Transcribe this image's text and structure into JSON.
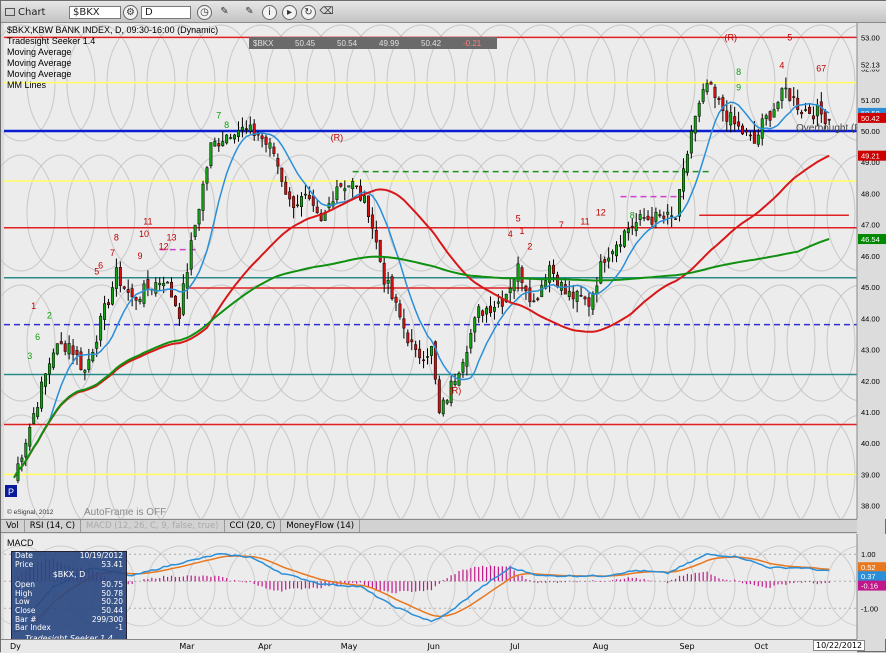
{
  "toolbar": {
    "chart_label": "Chart",
    "symbol": "$BKX",
    "interval": "D"
  },
  "header": {
    "title": "$BKX,KBW BANK INDEX, D, 09:30-16:00 (Dynamic)",
    "quote_symbol": "$BKX",
    "quote_1": "50.45",
    "quote_2": "50.54",
    "quote_3": "49.99",
    "quote_4": "50.42",
    "quote_5": "-0.21"
  },
  "studies": [
    "Tradesight Seeker 1.4",
    "Moving Average",
    "Moving Average",
    "Moving Average",
    "MM Lines"
  ],
  "notes": {
    "overbought": "Overbought (F",
    "autoframe": "AutoFrame is OFF",
    "copyright": "© eSignal, 2012"
  },
  "price_axis": {
    "ticks": [
      "53.00",
      "52.00",
      "51.00",
      "50.00",
      "49.00",
      "48.00",
      "47.00",
      "46.00",
      "45.00",
      "44.00",
      "43.00",
      "42.00",
      "41.00",
      "40.00",
      "39.00",
      "38.00"
    ],
    "tags": [
      {
        "text": "52.13",
        "value": 52.13,
        "color": "#dcdcdc",
        "fg": "#000"
      },
      {
        "text": "50.58",
        "value": 50.58,
        "color": "#2a8fd8",
        "fg": "#fff"
      },
      {
        "text": "50.42",
        "value": 50.42,
        "color": "#cc0000",
        "fg": "#fff"
      },
      {
        "text": "49.21",
        "value": 49.21,
        "color": "#cc0000",
        "fg": "#fff"
      },
      {
        "text": "46.54",
        "value": 46.54,
        "color": "#008800",
        "fg": "#fff"
      }
    ]
  },
  "macd_axis": {
    "ticks": [
      "1.00",
      "0.00",
      "-1.00"
    ],
    "tags": [
      {
        "text": "0.52",
        "value": 0.52,
        "color": "#e87820"
      },
      {
        "text": "0.37",
        "value": 0.37,
        "color": "#2a8fd8"
      },
      {
        "text": "-0.16",
        "value": -0.16,
        "color": "#c0188a"
      }
    ]
  },
  "tabs": [
    {
      "label": "Vol",
      "dim": false
    },
    {
      "label": "RSI (14, C)",
      "dim": false
    },
    {
      "label": "MACD (12, 26, C, 9, false, true)",
      "dim": true
    },
    {
      "label": "CCI (20, C)",
      "dim": false
    },
    {
      "label": "MoneyFlow (14)",
      "dim": false
    }
  ],
  "macd": {
    "label": "MACD"
  },
  "info_window": {
    "date_label": "Date",
    "date": "10/19/2012",
    "price_label": "Price",
    "price": "53.41",
    "symbol": "$BKX, D",
    "open_label": "Open",
    "open": "50.75",
    "high_label": "High",
    "high": "50.78",
    "low_label": "Low",
    "low": "50.20",
    "close_label": "Close",
    "close": "50.44",
    "bar_label": "Bar #",
    "bar": "299/300",
    "bar_index_label": "Bar Index",
    "bar_index": "-1",
    "study": "Tradesight Seeker 1.4"
  },
  "x_axis": {
    "labels": [
      {
        "text": "Dy",
        "day": 0
      },
      {
        "text": "Mar",
        "day": 43
      },
      {
        "text": "Apr",
        "day": 63
      },
      {
        "text": "May",
        "day": 84
      },
      {
        "text": "Jun",
        "day": 106
      },
      {
        "text": "Jul",
        "day": 127
      },
      {
        "text": "Aug",
        "day": 148
      },
      {
        "text": "Sep",
        "day": 170
      },
      {
        "text": "Oct",
        "day": 189
      }
    ],
    "current_date": "10/22/2012"
  },
  "chart_data": {
    "type": "candlestick",
    "title": "$BKX,KBW BANK INDEX, D, 09:30-16:00 (Dynamic)",
    "ylim": [
      37.7,
      53.3
    ],
    "bars": 210,
    "anchors": [
      [
        0,
        38.9
      ],
      [
        10,
        43.0
      ],
      [
        14,
        43.2
      ],
      [
        18,
        42.3
      ],
      [
        26,
        45.4
      ],
      [
        30,
        44.6
      ],
      [
        38,
        45.3
      ],
      [
        42,
        44.2
      ],
      [
        46,
        47.0
      ],
      [
        50,
        49.5
      ],
      [
        56,
        50.1
      ],
      [
        62,
        49.9
      ],
      [
        66,
        49.3
      ],
      [
        70,
        47.7
      ],
      [
        74,
        47.8
      ],
      [
        78,
        47.0
      ],
      [
        82,
        48.3
      ],
      [
        86,
        48.3
      ],
      [
        90,
        47.5
      ],
      [
        94,
        45.3
      ],
      [
        98,
        44.0
      ],
      [
        102,
        42.8
      ],
      [
        106,
        43.0
      ],
      [
        108,
        40.9
      ],
      [
        110,
        41.5
      ],
      [
        114,
        42.8
      ],
      [
        118,
        44.2
      ],
      [
        124,
        44.6
      ],
      [
        128,
        45.6
      ],
      [
        132,
        44.5
      ],
      [
        136,
        45.7
      ],
      [
        140,
        44.8
      ],
      [
        146,
        44.5
      ],
      [
        150,
        46.0
      ],
      [
        156,
        46.9
      ],
      [
        160,
        47.2
      ],
      [
        164,
        47.2
      ],
      [
        168,
        47.2
      ],
      [
        172,
        50.0
      ],
      [
        176,
        51.5
      ],
      [
        178,
        51.0
      ],
      [
        183,
        50.2
      ],
      [
        188,
        49.6
      ],
      [
        190,
        50.2
      ],
      [
        196,
        51.3
      ],
      [
        200,
        50.7
      ],
      [
        204,
        50.6
      ],
      [
        207,
        50.4
      ]
    ],
    "moving_averages": [
      {
        "name": "Moving Average",
        "color": "#2a8fd8",
        "last": 50.58
      },
      {
        "name": "Moving Average",
        "color": "#d81818",
        "last": 49.21
      },
      {
        "name": "Moving Average",
        "color": "#109010",
        "last": 46.54
      }
    ],
    "horizontal_lines": [
      {
        "value": 53.0,
        "color": "#e02020"
      },
      {
        "value": 51.55,
        "color": "#ffff60"
      },
      {
        "value": 50.0,
        "color": "#0b1fd0",
        "width": 2.5
      },
      {
        "value": 48.4,
        "color": "#ffff60"
      },
      {
        "value": 46.9,
        "color": "#e02020"
      },
      {
        "value": 45.3,
        "color": "#2a8a8a"
      },
      {
        "value": 44.97,
        "color": "#e02020",
        "from_day": 44,
        "to_day": 130
      },
      {
        "value": 43.8,
        "color": "#3030d0",
        "dash": true
      },
      {
        "value": 42.2,
        "color": "#2a8a8a"
      },
      {
        "value": 40.6,
        "color": "#e02020"
      },
      {
        "value": 39.0,
        "color": "#ffff60"
      },
      {
        "value": 48.7,
        "color": "#209020",
        "dash": true,
        "from_day": 86,
        "to_day": 177
      },
      {
        "value": 47.9,
        "color": "#d040d0",
        "dash": true,
        "from_day": 154,
        "to_day": 170
      },
      {
        "value": 47.3,
        "color": "#e02020",
        "from_day": 174,
        "to_day": 212
      },
      {
        "value": 46.2,
        "color": "#d040d0",
        "dash": true,
        "from_day": 37,
        "to_day": 47
      }
    ],
    "annotations": [
      {
        "day": 5,
        "value": 44.3,
        "text": "1",
        "c": "r"
      },
      {
        "day": 9,
        "value": 44.0,
        "text": "2",
        "c": "g"
      },
      {
        "day": 4,
        "value": 42.7,
        "text": "3",
        "c": "g"
      },
      {
        "day": 6,
        "value": 43.3,
        "text": "6",
        "c": "g"
      },
      {
        "day": 21,
        "value": 45.4,
        "text": "5",
        "c": "r"
      },
      {
        "day": 22,
        "value": 45.6,
        "text": "6",
        "c": "r"
      },
      {
        "day": 25,
        "value": 46.0,
        "text": "7",
        "c": "r"
      },
      {
        "day": 26,
        "value": 46.5,
        "text": "8",
        "c": "r"
      },
      {
        "day": 32,
        "value": 45.9,
        "text": "9",
        "c": "r"
      },
      {
        "day": 33,
        "value": 46.6,
        "text": "10",
        "c": "r"
      },
      {
        "day": 34,
        "value": 47.0,
        "text": "11",
        "c": "r"
      },
      {
        "day": 38,
        "value": 46.2,
        "text": "12",
        "c": "r"
      },
      {
        "day": 40,
        "value": 46.5,
        "text": "13",
        "c": "r"
      },
      {
        "day": 52,
        "value": 50.4,
        "text": "7",
        "c": "g"
      },
      {
        "day": 54,
        "value": 50.1,
        "text": "8",
        "c": "g"
      },
      {
        "day": 82,
        "value": 49.7,
        "text": "(R)",
        "c": "r"
      },
      {
        "day": 112,
        "value": 41.6,
        "text": "(R)",
        "c": "r"
      },
      {
        "day": 129,
        "value": 46.7,
        "text": "1",
        "c": "r"
      },
      {
        "day": 131,
        "value": 46.2,
        "text": "2",
        "c": "r"
      },
      {
        "day": 126,
        "value": 46.6,
        "text": "4",
        "c": "r"
      },
      {
        "day": 128,
        "value": 47.1,
        "text": "5",
        "c": "r"
      },
      {
        "day": 139,
        "value": 46.9,
        "text": "7",
        "c": "r"
      },
      {
        "day": 145,
        "value": 47.0,
        "text": "11",
        "c": "r"
      },
      {
        "day": 149,
        "value": 47.3,
        "text": "12",
        "c": "r"
      },
      {
        "day": 157,
        "value": 47.2,
        "text": "8",
        "c": "g"
      },
      {
        "day": 182,
        "value": 52.9,
        "text": "(R)",
        "c": "r"
      },
      {
        "day": 197,
        "value": 52.9,
        "text": "5",
        "c": "r"
      },
      {
        "day": 195,
        "value": 52.0,
        "text": "4",
        "c": "r"
      },
      {
        "day": 205,
        "value": 51.9,
        "text": "67",
        "c": "r"
      },
      {
        "day": 184,
        "value": 51.8,
        "text": "8",
        "c": "g"
      },
      {
        "day": 184,
        "value": 51.3,
        "text": "9",
        "c": "g"
      }
    ],
    "macd": {
      "ylim": [
        -2.1,
        1.6
      ],
      "macd_color": "#2a8fd8",
      "signal_color": "#e87820",
      "hist_color": "#c0188a",
      "anchors": [
        [
          0,
          -1.9
        ],
        [
          10,
          -0.2
        ],
        [
          20,
          0.5
        ],
        [
          30,
          0.2
        ],
        [
          40,
          0.6
        ],
        [
          52,
          1.0
        ],
        [
          60,
          0.9
        ],
        [
          68,
          0.3
        ],
        [
          78,
          -0.1
        ],
        [
          88,
          -0.2
        ],
        [
          96,
          -0.9
        ],
        [
          106,
          -1.5
        ],
        [
          110,
          -1.2
        ],
        [
          118,
          -0.3
        ],
        [
          126,
          0.5
        ],
        [
          134,
          0.2
        ],
        [
          142,
          0.2
        ],
        [
          150,
          0.2
        ],
        [
          158,
          0.4
        ],
        [
          166,
          0.3
        ],
        [
          176,
          1.0
        ],
        [
          184,
          0.9
        ],
        [
          192,
          0.5
        ],
        [
          200,
          0.5
        ],
        [
          207,
          0.37
        ]
      ]
    }
  }
}
